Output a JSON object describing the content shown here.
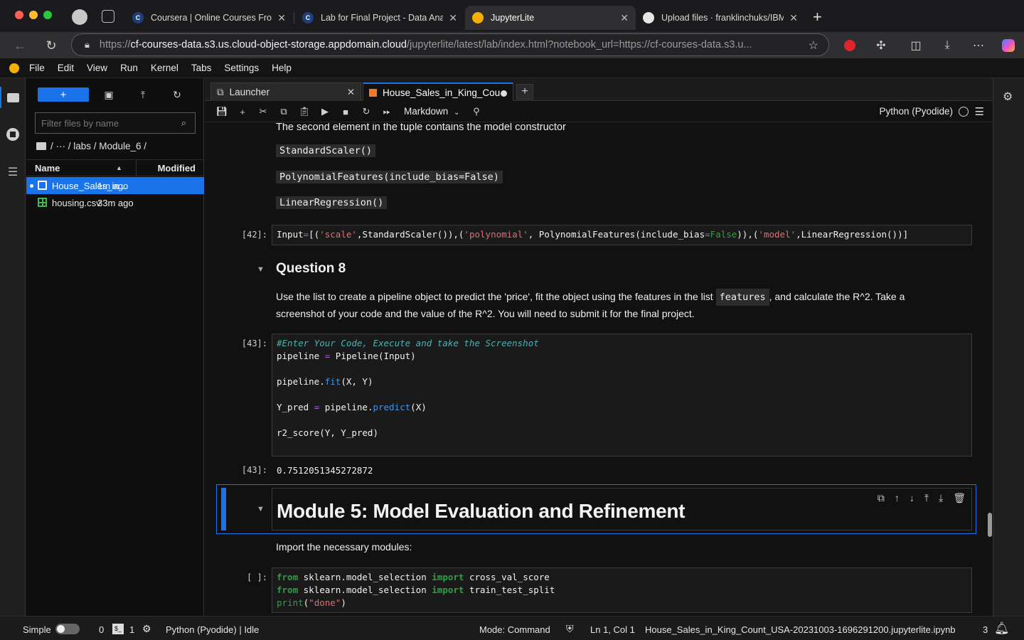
{
  "browser": {
    "tabs": [
      {
        "title": "Coursera | Online Courses From",
        "icon": "coursera-icon"
      },
      {
        "title": "Lab for Final Project - Data Ana",
        "icon": "coursera-icon"
      },
      {
        "title": "JupyterLite",
        "icon": "jupyter-icon"
      },
      {
        "title": "Upload files · franklinchuks/IBM",
        "icon": "github-icon"
      }
    ],
    "url_scheme": "https://",
    "url_host": "cf-courses-data.s3.us.cloud-object-storage.appdomain.cloud",
    "url_path": "/jupyterlite/latest/lab/index.html?notebook_url=https://cf-courses-data.s3.u..."
  },
  "menu": [
    "File",
    "Edit",
    "View",
    "Run",
    "Kernel",
    "Tabs",
    "Settings",
    "Help"
  ],
  "filebrowser": {
    "filter_placeholder": "Filter files by name",
    "breadcrumb": "/ ··· / labs / Module_6 /",
    "col_name": "Name",
    "col_modified": "Modified",
    "files": [
      {
        "name": "House_Sales_in...",
        "modified": "1m ago"
      },
      {
        "name": "housing.csv",
        "modified": "33m ago"
      }
    ]
  },
  "doctabs": {
    "launcher": "Launcher",
    "notebook": "House_Sales_in_King_Cou"
  },
  "toolbar": {
    "cell_type": "Markdown",
    "kernel": "Python (Pyodide)"
  },
  "cells": {
    "md_tuple_text": "The second element in the tuple contains the model constructor",
    "code1": "StandardScaler()",
    "code2": "PolynomialFeatures(include_bias=False)",
    "code3": "LinearRegression()",
    "prompt42": "[42]:",
    "prompt43": "[43]:",
    "out43_prompt": "[43]:",
    "out43_value": "0.7512051345272872",
    "q8_title": "Question 8",
    "q8_text_a": "Use the list to create a pipeline object to predict the 'price', fit the object using the features in the list",
    "q8_code": "features",
    "q8_text_b": ", and calculate the R^2. Take a",
    "q8_text_c": "screenshot of your code and the value of the R^2. You will need to submit it for the final project.",
    "module5_title": "Module 5: Model Evaluation and Refinement",
    "import_text": "Import the necessary modules:",
    "prompt_empty": "[ ]:"
  },
  "statusbar": {
    "mode_label": "Simple",
    "terminals": "0",
    "kernels": "1",
    "kernel_status": "Python (Pyodide) | Idle",
    "mode": "Mode: Command",
    "cursor": "Ln 1, Col 1",
    "filename": "House_Sales_in_King_Count_USA-20231003-1696291200.jupyterlite.ipynb",
    "notifications": "3"
  }
}
